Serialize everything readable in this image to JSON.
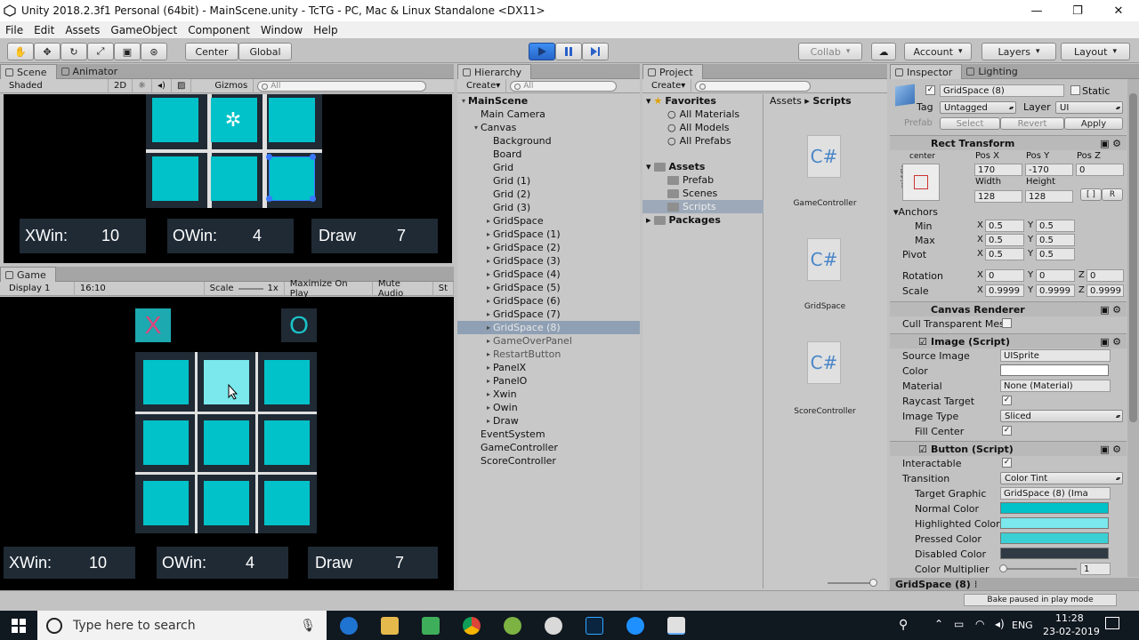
{
  "window": {
    "title": "Unity 2018.2.3f1 Personal (64bit) - MainScene.unity - TcTG - PC, Mac & Linux Standalone <DX11>"
  },
  "menu": [
    "File",
    "Edit",
    "Assets",
    "GameObject",
    "Component",
    "Window",
    "Help"
  ],
  "toolbar": {
    "center": "Center",
    "global": "Global",
    "collab": "Collab",
    "account": "Account",
    "layers": "Layers",
    "layout": "Layout"
  },
  "scene": {
    "tabs": [
      "Scene",
      "Animator"
    ],
    "shading": "Shaded",
    "mode2d": "2D",
    "gizmos": "Gizmos",
    "search": "All",
    "labels": [
      {
        "name": "XWin:",
        "value": "10"
      },
      {
        "name": "OWin:",
        "value": "4"
      },
      {
        "name": "Draw",
        "value": "7"
      }
    ]
  },
  "game": {
    "tab": "Game",
    "display": "Display 1",
    "aspect": "16:10",
    "scale_label": "Scale",
    "scale_value": "1x",
    "maximize": "Maximize On Play",
    "mute": "Mute Audio",
    "stats": "St",
    "x_mark": "X",
    "o_mark": "O",
    "labels": [
      {
        "name": "XWin:",
        "value": "10"
      },
      {
        "name": "OWin:",
        "value": "4"
      },
      {
        "name": "Draw",
        "value": "7"
      }
    ]
  },
  "hierarchy": {
    "tab": "Hierarchy",
    "create": "Create",
    "search": "All",
    "scene": "MainScene",
    "items": [
      "Main Camera",
      "Canvas",
      "Background",
      "Board",
      "Grid",
      "Grid (1)",
      "Grid (2)",
      "Grid (3)",
      "GridSpace",
      "GridSpace (1)",
      "GridSpace (2)",
      "GridSpace (3)",
      "GridSpace (4)",
      "GridSpace (5)",
      "GridSpace (6)",
      "GridSpace (7)",
      "GridSpace (8)",
      "GameOverPanel",
      "RestartButton",
      "PanelX",
      "PanelO",
      "Xwin",
      "Owin",
      "Draw",
      "EventSystem",
      "GameController",
      "ScoreController"
    ]
  },
  "project": {
    "tab": "Project",
    "create": "Create",
    "favorites": "Favorites",
    "fav_items": [
      "All Materials",
      "All Models",
      "All Prefabs"
    ],
    "assets": "Assets",
    "asset_items": [
      "Prefab",
      "Scenes",
      "Scripts"
    ],
    "packages": "Packages",
    "breadcrumb": [
      "Assets",
      "Scripts"
    ],
    "scripts": [
      {
        "icon": "C#",
        "name": "GameController"
      },
      {
        "icon": "C#",
        "name": "GridSpace"
      },
      {
        "icon": "C#",
        "name": "ScoreController"
      }
    ]
  },
  "inspector": {
    "tabs": [
      "Inspector",
      "Lighting"
    ],
    "object_name": "GridSpace (8)",
    "static": "Static",
    "tag_label": "Tag",
    "tag": "Untagged",
    "layer_label": "Layer",
    "layer": "UI",
    "prefab": "Prefab",
    "select": "Select",
    "revert": "Revert",
    "apply": "Apply",
    "rect": {
      "title": "Rect Transform",
      "anchor_preset": "center",
      "middle": "middle",
      "pos_x_label": "Pos X",
      "pos_y_label": "Pos Y",
      "pos_z_label": "Pos Z",
      "pos_x": "170",
      "pos_y": "-170",
      "pos_z": "0",
      "width_label": "Width",
      "height_label": "Height",
      "width": "128",
      "height": "128",
      "r_label": "R",
      "anchors": "Anchors",
      "min": "Min",
      "max": "Max",
      "pivot": "Pivot",
      "min_x": "0.5",
      "min_y": "0.5",
      "max_x": "0.5",
      "max_y": "0.5",
      "pivot_x": "0.5",
      "pivot_y": "0.5",
      "rotation": "Rotation",
      "rot_x": "0",
      "rot_y": "0",
      "rot_z": "0",
      "scale": "Scale",
      "sc_x": "0.9999",
      "sc_y": "0.9999",
      "sc_z": "0.9999"
    },
    "canvas_renderer": {
      "title": "Canvas Renderer",
      "cull": "Cull Transparent Mes"
    },
    "image": {
      "title": "Image (Script)",
      "source_label": "Source Image",
      "source": "UISprite",
      "color_label": "Color",
      "material_label": "Material",
      "material": "None (Material)",
      "raycast": "Raycast Target",
      "type_label": "Image Type",
      "type": "Sliced",
      "fill": "Fill Center"
    },
    "button": {
      "title": "Button (Script)",
      "interactable": "Interactable",
      "transition_label": "Transition",
      "transition": "Color Tint",
      "target_label": "Target Graphic",
      "target": "GridSpace (8) (Ima",
      "normal": "Normal Color",
      "highlighted": "Highlighted Color",
      "pressed": "Pressed Color",
      "disabled": "Disabled Color",
      "multiplier": "Color Multiplier",
      "multiplier_value": "1"
    },
    "footer": "GridSpace (8)"
  },
  "status": {
    "bake": "Bake paused in play mode"
  },
  "taskbar": {
    "search": "Type here to search",
    "lang": "ENG",
    "time": "11:28",
    "date": "23-02-2019"
  },
  "colors": {
    "cell": "#00c2c8",
    "cell_highlight": "#7ae8ec",
    "normal": "#00c2c8",
    "highlighted": "#7ae8ec",
    "pressed": "#3bd0d4",
    "disabled": "#2f3a44"
  }
}
